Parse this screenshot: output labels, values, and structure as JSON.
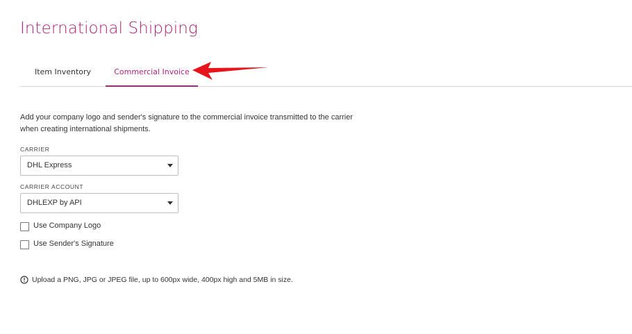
{
  "page": {
    "title": "International Shipping"
  },
  "tabs": [
    {
      "label": "Item Inventory",
      "active": false
    },
    {
      "label": "Commercial Invoice",
      "active": true
    }
  ],
  "annotation": {
    "arrow_color": "#e8141c"
  },
  "form": {
    "description": "Add your company logo and sender's signature to the commercial invoice transmitted to the carrier when creating international shipments.",
    "carrier": {
      "label": "CARRIER",
      "value": "DHL Express"
    },
    "carrier_account": {
      "label": "CARRIER ACCOUNT",
      "value": "DHLEXP by API"
    },
    "checkboxes": [
      {
        "label": "Use Company Logo",
        "checked": false
      },
      {
        "label": "Use Sender's Signature",
        "checked": false
      }
    ],
    "info": "Upload a PNG, JPG or JPEG file, up to 600px wide, 400px high and 5MB in size."
  },
  "colors": {
    "accent": "#b0217a",
    "text": "#333333",
    "border": "#bdbdbd"
  },
  "icons": {
    "select_caret": "chevron-down-icon",
    "info": "info-circle-icon",
    "annotation": "arrow-left-icon"
  }
}
